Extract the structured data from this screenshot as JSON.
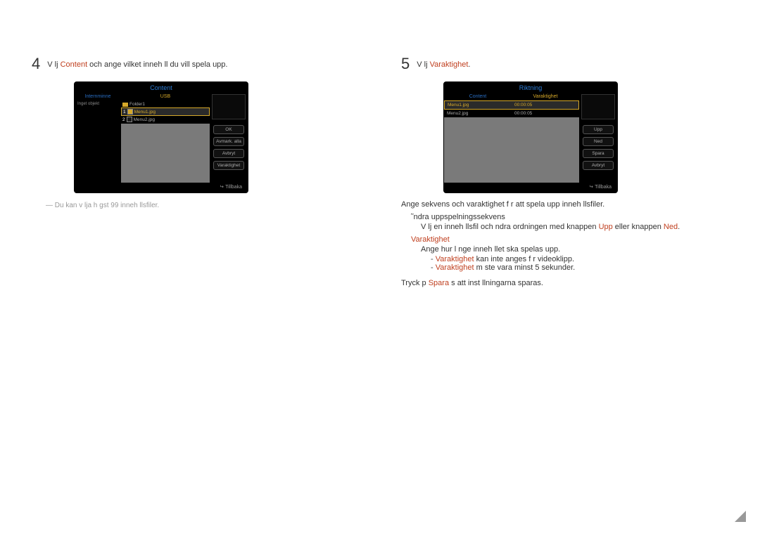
{
  "left": {
    "step_num": "4",
    "step_pre": "V lj ",
    "step_hl": "Content",
    "step_post": " och ange vilket inneh ll du vill spela upp.",
    "note": "Du kan v lja h gst 99 inneh llsfiler.",
    "shot": {
      "title": "Content",
      "tab1": "Internminne",
      "tab2": "USB",
      "noobj": "Inget objekt",
      "folder": "Folder1",
      "file1": "Menu1.jpg",
      "file2": "Menu2.jpg",
      "btn_ok": "OK",
      "btn_unmark": "Avmark. alla",
      "btn_cancel": "Avbryt",
      "btn_duration": "Varaktighet",
      "back": "Tillbaka"
    }
  },
  "right": {
    "step_num": "5",
    "step_pre": "V lj ",
    "step_hl": "Varaktighet",
    "step_post": ".",
    "shot": {
      "title": "Riktning",
      "col1": "Content",
      "col2": "Varaktighet",
      "file1": "Menu1.jpg",
      "file2": "Menu2.jpg",
      "dur": "00:00:05",
      "btn_up": "Upp",
      "btn_down": "Ned",
      "btn_save": "Spara",
      "btn_cancel": "Avbryt",
      "back": "Tillbaka"
    },
    "p1": "Ange sekvens och varaktighet f r att spela upp inneh llsfiler.",
    "b1_head": "˜ndra uppspelningssekvens",
    "b1_body_a": "V lj en inneh llsfil och  ndra ordningen med knappen ",
    "b1_body_up": "Upp",
    "b1_body_mid": " eller knappen ",
    "b1_body_down": "Ned",
    "b1_body_end": ".",
    "b2_head": "Varaktighet",
    "b2_body": "Ange hur l nge inneh llet ska spelas upp.",
    "d1a": "Varaktighet",
    "d1b": " kan inte anges f r videoklipp.",
    "d2a": "Varaktighet",
    "d2b": " m ste vara minst 5 sekunder.",
    "p2a": "Tryck p  ",
    "p2hl": "Spara",
    "p2b": " s  att inst llningarna sparas."
  }
}
